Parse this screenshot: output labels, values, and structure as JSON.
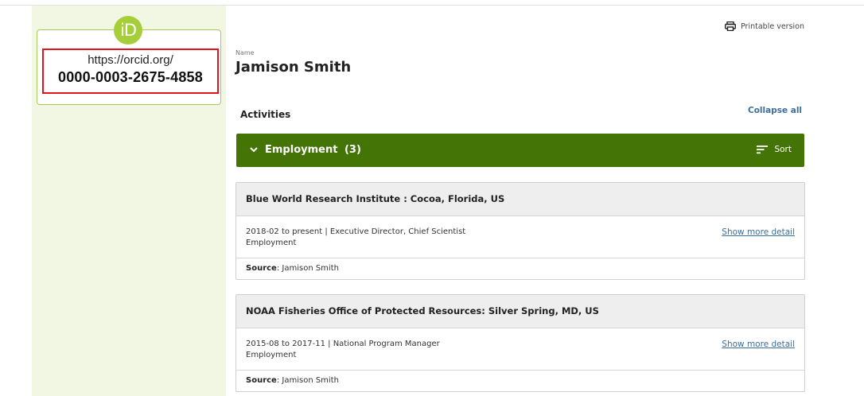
{
  "orcid": {
    "logo_text": "iD",
    "url_prefix": "https://orcid.org/",
    "id": "0000-0003-2675-4858"
  },
  "header": {
    "print_label": "Printable version",
    "name_label": "Name",
    "name_value": "Jamison Smith"
  },
  "activities": {
    "title": "Activities",
    "collapse_label": "Collapse all"
  },
  "employment": {
    "title": "Employment",
    "count": "(3)",
    "sort_label": "Sort",
    "items": [
      {
        "org": "Blue World Research Institute : Cocoa, Florida, US",
        "detail": "2018-02 to present | Executive Director, Chief Scientist",
        "type": "Employment",
        "show_more": "Show more detail",
        "source_label": "Source",
        "source_value": ": Jamison Smith"
      },
      {
        "org": "NOAA Fisheries Office of Protected Resources: Silver Spring, MD, US",
        "detail": "2015-08 to 2017-11 | National Program Manager",
        "type": "Employment",
        "show_more": "Show more detail",
        "source_label": "Source",
        "source_value": ": Jamison Smith"
      }
    ]
  },
  "colors": {
    "brand_green": "#447405",
    "orcid_green": "#a6ce39",
    "link_blue": "#3d6e99",
    "highlight_red": "#e0141b"
  }
}
